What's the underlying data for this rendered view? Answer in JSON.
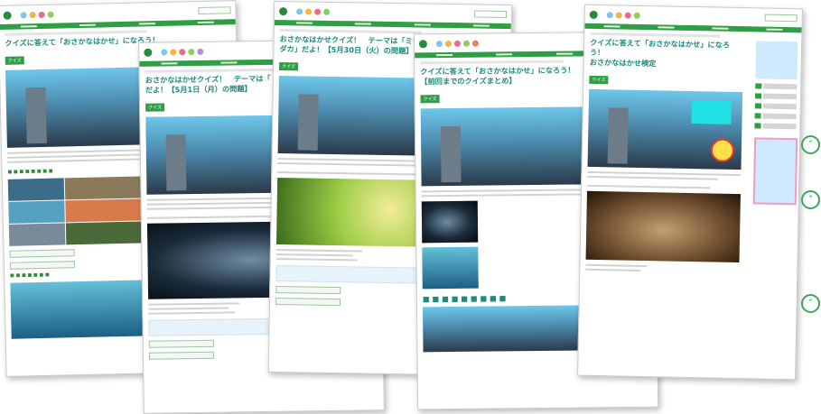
{
  "pages": [
    {
      "title": "クイズに答えて「おさかなはかせ」になろう！",
      "tag": "クイズ"
    },
    {
      "title": "おさかなはかせクイズ！　テーマは「\nだよ！【5月1日（月）の問題】",
      "tag": "クイズ"
    },
    {
      "title": "おさかなはかせクイズ！　テーマは「ミナ\nダカ」だよ！【5月30日（火）の問題】",
      "tag": "クイズ"
    },
    {
      "title": "クイズに答えて「おさかなはかせ」になろう！\n【前回までのクイズまとめ】",
      "tag": "クイズ"
    },
    {
      "title": "クイズに答えて「おさかなはかせ」になろう！\nおさかなはかせ検定",
      "tag": "クイズ"
    }
  ],
  "colors": {
    "brand_green": "#2f9e44",
    "title_teal": "#1d8c7a",
    "accent_cyan": "#21e0e6"
  },
  "icons": {
    "scroll_top": "chevron-up-icon"
  }
}
